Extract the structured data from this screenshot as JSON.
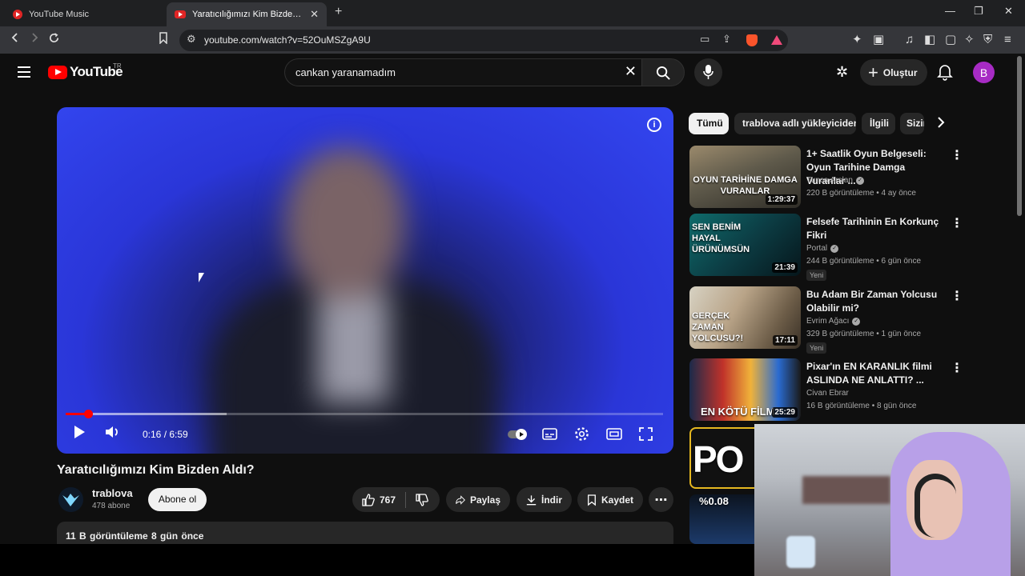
{
  "browser": {
    "tabs": [
      {
        "title": "YouTube Music"
      },
      {
        "title": "Yaratıcılığımızı Kim Bizden Aldı?"
      }
    ],
    "url": "youtube.com/watch?v=52OuMSZgA9U"
  },
  "masthead": {
    "logo_text": "YouTube",
    "country_code": "TR",
    "search_value": "cankan yaranamadım",
    "create_label": "Oluştur",
    "avatar_letter": "B"
  },
  "player": {
    "time_display": "0:16 / 6:59",
    "progress_fraction": 0.038,
    "buffered_fraction": 0.27
  },
  "video": {
    "title": "Yaratıcılığımızı Kim Bizden Aldı?",
    "channel_name": "trablova",
    "subscribers": "478 abone",
    "subscribe_label": "Abone ol",
    "like_count": "767",
    "share_label": "Paylaş",
    "download_label": "İndir",
    "save_label": "Kaydet",
    "views": "11 B görüntüleme",
    "date": "8 gün önce"
  },
  "chips": [
    "Tümü",
    "trablova adlı yükleyiciden",
    "İlgili",
    "Sizin için"
  ],
  "recommendations": [
    {
      "title": "1+ Saatlik Oyun Belgeseli: Oyun Tarihine Damga Vuranlar ...",
      "channel": "Tunca Arslan",
      "meta": "220 B görüntüleme • 4 ay önce",
      "duration": "1:29:37",
      "thumb_text": "OYUN TARİHİNE DAMGA VURANLAR",
      "badge": ""
    },
    {
      "title": "Felsefe Tarihinin En Korkunç Fikri",
      "channel": "Portal",
      "meta": "244 B görüntüleme • 6 gün önce",
      "duration": "21:39",
      "thumb_text": "SEN BENİM HAYAL ÜRÜNÜMSÜN",
      "badge": "Yeni"
    },
    {
      "title": "Bu Adam Bir Zaman Yolcusu Olabilir mi?",
      "channel": "Evrim Ağacı",
      "meta": "329 B görüntüleme • 1 gün önce",
      "duration": "17:11",
      "thumb_text": "GERÇEK ZAMAN YOLCUSU?!",
      "badge": "Yeni"
    },
    {
      "title": "Pixar'ın EN KARANLIK filmi ASLINDA NE ANLATTI? ...",
      "channel": "Civan Ebrar",
      "meta": "16 B görüntüleme • 8 gün önce",
      "duration": "25:29",
      "thumb_text": "EN KÖTÜ FİLM",
      "badge": ""
    }
  ],
  "partial_thumbs": [
    "PO",
    "%0.08"
  ],
  "colors": {
    "accent": "#ff0000",
    "background": "#0f0f0f",
    "surface": "#272727",
    "avatar": "#a72bc4"
  }
}
